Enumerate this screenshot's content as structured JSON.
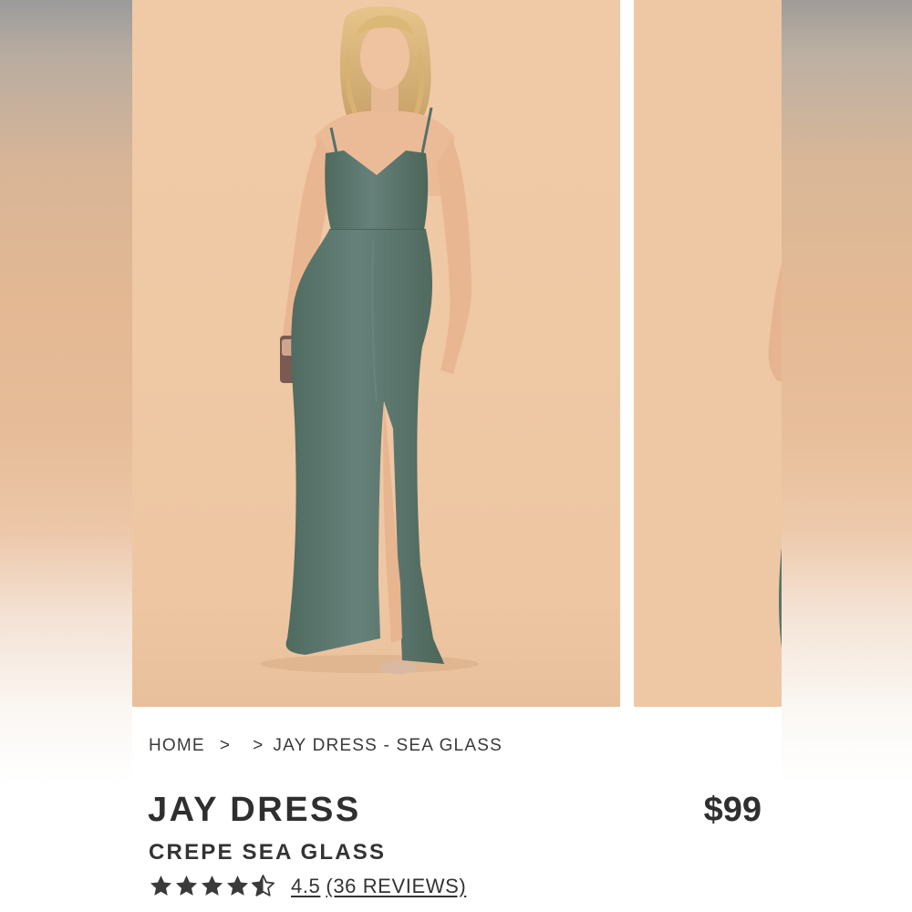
{
  "breadcrumb": {
    "home": "HOME",
    "separator": ">",
    "current": "JAY DRESS - SEA GLASS"
  },
  "product": {
    "name": "JAY DRESS",
    "variant": "CREPE SEA GLASS",
    "price": "$99",
    "rating_value": "4.5",
    "reviews_label": "(36 REVIEWS)",
    "stars": {
      "filled": 4.5,
      "max": 5
    }
  },
  "colors": {
    "dress": "#5f7a6e",
    "backdrop": "#efc8a5",
    "text": "#2f2f2f"
  },
  "icons": {
    "star": "star-icon",
    "half_star": "star-half-icon"
  }
}
